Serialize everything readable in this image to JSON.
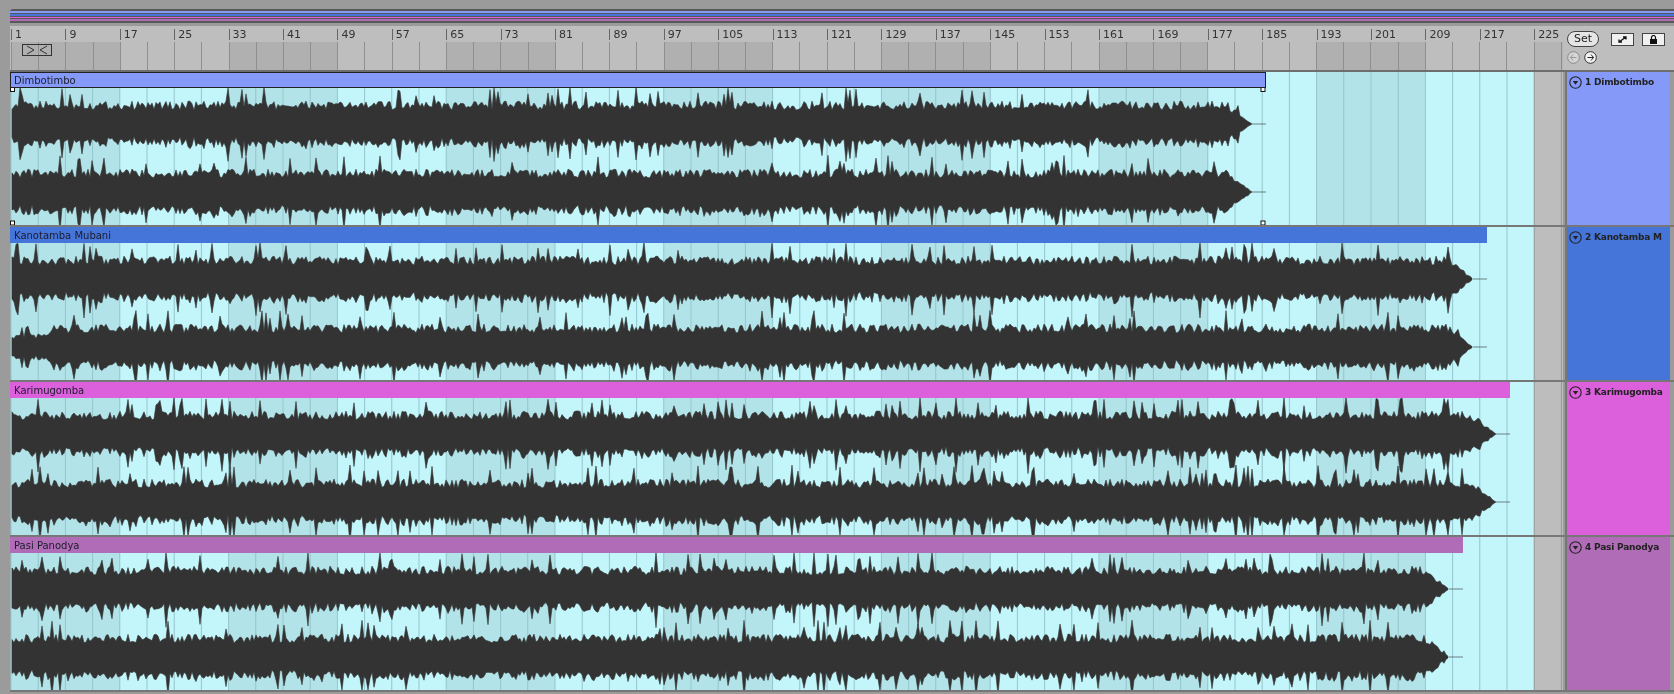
{
  "ruler": {
    "bars": [
      "1",
      "9",
      "17",
      "25",
      "33",
      "41",
      "49",
      "57",
      "65",
      "73",
      "81",
      "89",
      "97",
      "105",
      "113",
      "121",
      "129",
      "137",
      "145",
      "153",
      "161",
      "169",
      "177",
      "185",
      "193",
      "201",
      "209",
      "217",
      "225"
    ]
  },
  "controls": {
    "set_button": "Set"
  },
  "tracks": [
    {
      "clip_name": "Dimbotimbo",
      "header": "1 Dimbotimbo",
      "color": "#8599f8",
      "selected": true
    },
    {
      "clip_name": "Kanotamba Mubani",
      "header": "2 Kanotamba M",
      "color": "#4575d9",
      "selected": false
    },
    {
      "clip_name": "Karimugomba",
      "header": "3 Karimugomba",
      "color": "#dc5fdc",
      "selected": false
    },
    {
      "clip_name": "Pasi Panodya",
      "header": "4 Pasi Panodya",
      "color": "#b06cb6",
      "selected": false
    }
  ]
}
